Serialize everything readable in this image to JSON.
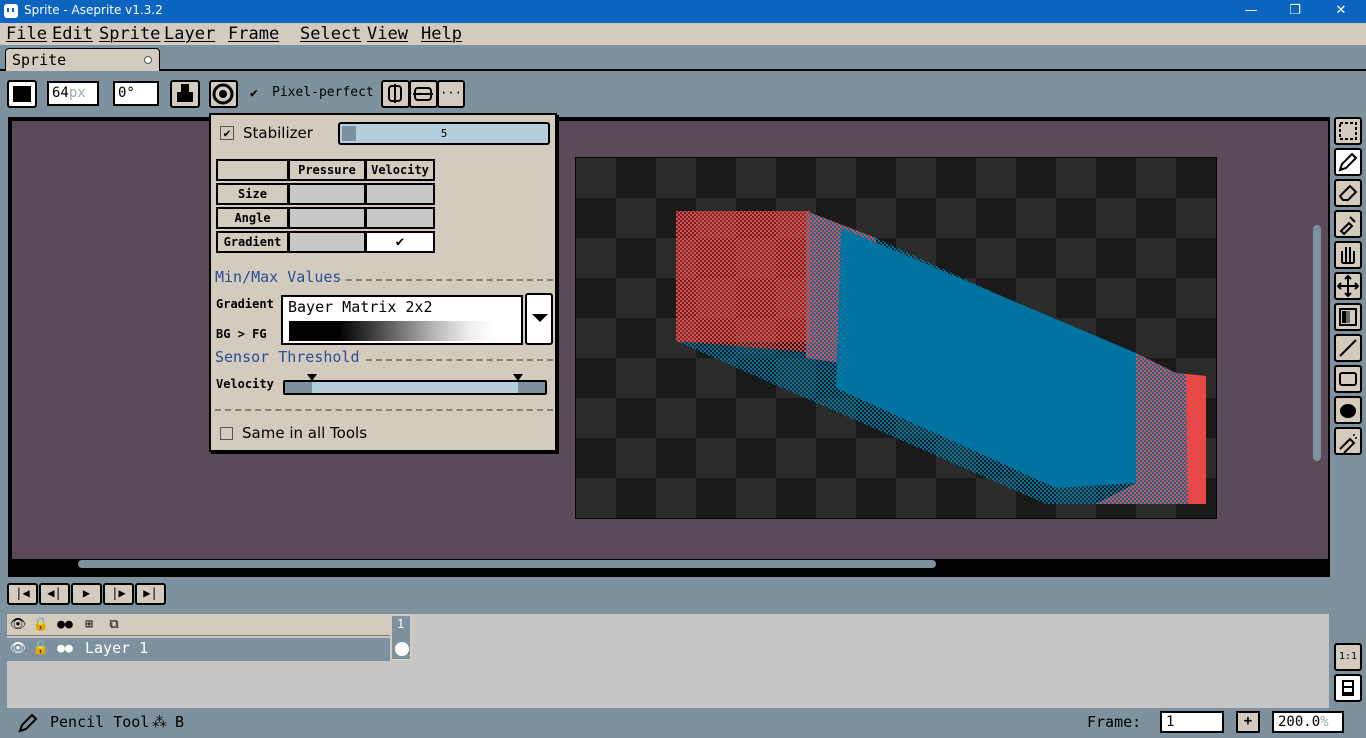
{
  "window": {
    "title": "Sprite - Aseprite v1.3.2",
    "minimize": "—",
    "maximize": "❐",
    "close": "✕"
  },
  "menu": [
    "File",
    "Edit",
    "Sprite",
    "Layer",
    "Frame",
    "Select",
    "View",
    "Help"
  ],
  "tab": {
    "label": "Sprite"
  },
  "contextbar": {
    "brush_size": "64",
    "brush_size_unit": "px",
    "angle": "0°",
    "pixel_perfect": "Pixel-perfect",
    "more": "···"
  },
  "stabilizer_popup": {
    "stabilizer_label": "Stabilizer",
    "stabilizer_value": "5",
    "headers": [
      "Pressure",
      "Velocity"
    ],
    "rows": [
      "Size",
      "Angle",
      "Gradient"
    ],
    "gradient_velocity_checked": "✔",
    "minmax_title": "Min/Max Values",
    "gradient_label": "Gradient",
    "bg_fg_label": "BG > FG",
    "gradient_value": "Bayer Matrix 2x2",
    "sensor_title": "Sensor Threshold",
    "velocity_label": "Velocity",
    "same_all_tools": "Same in all Tools"
  },
  "layers": {
    "frame_number": "1",
    "layer_name": "Layer 1"
  },
  "status": {
    "tool": "Pencil Tool",
    "shortcut": "B",
    "frame_label": "Frame:",
    "frame_value": "1",
    "add": "+",
    "zoom": "200.0",
    "zoom_unit": "%"
  },
  "zoom_buttons": {
    "one_to_one": "1:1"
  },
  "colors": {
    "accent": "#0a64c0",
    "panel": "#d3cbbe",
    "workspace": "#7d929e",
    "editor_bg": "#5b4b59",
    "stroke_red": "#e84848",
    "stroke_teal": "#0073a0"
  }
}
